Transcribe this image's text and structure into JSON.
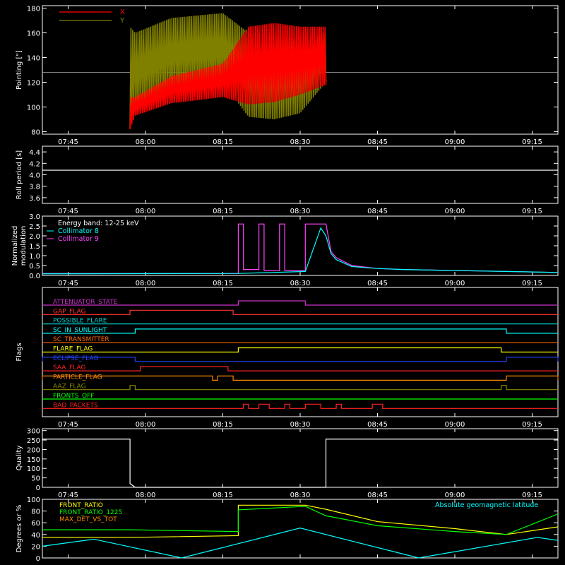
{
  "time_ticks": [
    "07:45",
    "08:00",
    "08:15",
    "08:30",
    "08:45",
    "09:00",
    "09:15"
  ],
  "chart_data": [
    {
      "type": "line",
      "ylabel": "Pointing [\"]",
      "ylim": [
        78,
        182
      ],
      "yticks": [
        "80",
        "100",
        "120",
        "140",
        "160",
        "180"
      ],
      "legend": [
        {
          "name": "X",
          "color": "#ff0000"
        },
        {
          "name": "Y",
          "color": "#808000"
        }
      ],
      "reference_level": 128,
      "series": [
        {
          "name": "X",
          "color": "#ff0000",
          "x": [
            "07:57",
            "07:58",
            "08:05",
            "08:15",
            "08:20",
            "08:25",
            "08:30",
            "08:35"
          ],
          "upper": [
            108,
            108,
            125,
            135,
            165,
            168,
            165,
            165
          ],
          "lower": [
            82,
            93,
            103,
            108,
            102,
            104,
            110,
            118
          ]
        },
        {
          "name": "Y",
          "color": "#808000",
          "x": [
            "07:57",
            "07:58",
            "08:05",
            "08:15",
            "08:20",
            "08:25",
            "08:30",
            "08:35"
          ],
          "upper": [
            165,
            160,
            172,
            176,
            160,
            158,
            155,
            160
          ],
          "lower": [
            82,
            100,
            115,
            120,
            92,
            90,
            95,
            120
          ]
        }
      ]
    },
    {
      "type": "line",
      "ylabel": "Roll period [s]",
      "ylim": [
        3.5,
        4.5
      ],
      "yticks": [
        "3.6",
        "3.8",
        "4.0",
        "4.2",
        "4.4"
      ],
      "series": [
        {
          "name": "roll",
          "color": "#ffffff",
          "x": [
            "07:40",
            "09:20"
          ],
          "y": [
            4.08,
            4.08
          ]
        }
      ]
    },
    {
      "type": "line",
      "ylabel": "Normalized modulation",
      "ylim": [
        0,
        3.0
      ],
      "yticks": [
        "0.0",
        "0.5",
        "1.0",
        "1.5",
        "2.0",
        "2.5",
        "3.0"
      ],
      "legend": [
        {
          "name": "Energy band: 12-25 keV",
          "color": "#ffffff"
        },
        {
          "name": "Collimator 8",
          "color": "#00ffff"
        },
        {
          "name": "Collimator 9",
          "color": "#ff44ff"
        }
      ],
      "series": [
        {
          "name": "Collimator 9",
          "color": "#ff44ff",
          "x": [
            "07:40",
            "08:18",
            "08:18",
            "08:19",
            "08:19",
            "08:22",
            "08:22",
            "08:23",
            "08:23",
            "08:26",
            "08:26",
            "08:27",
            "08:27",
            "08:31",
            "08:31",
            "08:35",
            "08:36",
            "08:37",
            "08:40",
            "08:45",
            "08:50",
            "09:00",
            "09:20"
          ],
          "y": [
            0.1,
            0.1,
            2.6,
            2.6,
            0.3,
            0.3,
            2.6,
            2.6,
            0.25,
            0.25,
            2.6,
            2.6,
            0.25,
            0.25,
            2.6,
            2.6,
            1.2,
            0.9,
            0.5,
            0.35,
            0.3,
            0.25,
            0.15
          ]
        },
        {
          "name": "Collimator 8",
          "color": "#00ffff",
          "x": [
            "07:40",
            "08:18",
            "08:31",
            "08:34",
            "08:35",
            "08:36",
            "08:37",
            "08:40",
            "08:45",
            "08:50",
            "09:00",
            "09:20"
          ],
          "y": [
            0.08,
            0.1,
            0.2,
            2.4,
            2.0,
            1.1,
            0.8,
            0.45,
            0.35,
            0.3,
            0.25,
            0.15
          ]
        }
      ]
    },
    {
      "type": "table",
      "ylabel": "Flags",
      "flags": [
        {
          "name": "ATTENUATOR_STATE",
          "color": "#cc33cc",
          "on": [
            [
              "08:18",
              "08:31"
            ]
          ]
        },
        {
          "name": "GAP_FLAG",
          "color": "#ff3333",
          "on": [
            [
              "07:57",
              "08:17"
            ]
          ]
        },
        {
          "name": "POSSIBLE_FLARE",
          "color": "#00cccc",
          "on": []
        },
        {
          "name": "SC_IN_SUNLIGHT",
          "color": "#00ffff",
          "on": [
            [
              "07:58",
              "09:10"
            ]
          ]
        },
        {
          "name": "SC_TRANSMITTER",
          "color": "#ff6600",
          "on": []
        },
        {
          "name": "FLARE_FLAG",
          "color": "#ffff00",
          "on": [
            [
              "08:18",
              "09:09"
            ]
          ]
        },
        {
          "name": "ECLIPSE_FLAG",
          "color": "#2244ff",
          "on": [
            [
              "07:40",
              "07:58"
            ],
            [
              "09:10",
              "09:20"
            ]
          ]
        },
        {
          "name": "SAA_FLAG",
          "color": "#ff2222",
          "on": [
            [
              "07:59",
              "08:16"
            ]
          ]
        },
        {
          "name": "PARTICLE_FLAG",
          "color": "#ff8800",
          "on": [
            [
              "07:40",
              "08:13"
            ],
            [
              "08:14",
              "08:17"
            ],
            [
              "09:10",
              "09:20"
            ]
          ]
        },
        {
          "name": "AAZ_FLAG",
          "color": "#888800",
          "on": [
            [
              "07:57",
              "07:58"
            ],
            [
              "09:09",
              "09:10"
            ]
          ]
        },
        {
          "name": "FRONTS_OFF",
          "color": "#00ff00",
          "on": []
        },
        {
          "name": "BAD_PACKETS",
          "color": "#ff2222",
          "on": [
            [
              "08:19",
              "08:20"
            ],
            [
              "08:22",
              "08:24"
            ],
            [
              "08:27",
              "08:28"
            ],
            [
              "08:31",
              "08:34"
            ],
            [
              "08:37",
              "08:38"
            ],
            [
              "08:44",
              "08:46"
            ]
          ]
        }
      ]
    },
    {
      "type": "line",
      "ylabel": "Quality",
      "ylim": [
        0,
        310
      ],
      "yticks": [
        "0",
        "50",
        "100",
        "150",
        "200",
        "250",
        "300"
      ],
      "series": [
        {
          "name": "Quality",
          "color": "#ffffff",
          "x": [
            "07:40",
            "07:57",
            "07:57",
            "07:58",
            "08:35",
            "08:35",
            "09:20"
          ],
          "y": [
            255,
            255,
            20,
            0,
            0,
            255,
            255
          ]
        }
      ]
    },
    {
      "type": "line",
      "ylabel": "Degrees or %",
      "ylim": [
        0,
        100
      ],
      "yticks": [
        "0",
        "20",
        "40",
        "60",
        "80",
        "100"
      ],
      "legend": [
        {
          "name": "FRONT_RATIO",
          "color": "#ffff00"
        },
        {
          "name": "FRONT_RATIO_1225",
          "color": "#00ff00"
        },
        {
          "name": "MAX_DET_VS_TOT",
          "color": "#ff8800"
        }
      ],
      "annotation": {
        "text": "Absolute geomagnetic latitude",
        "color": "#00ffff"
      },
      "series": [
        {
          "name": "FRONT_RATIO",
          "color": "#ffff00",
          "x": [
            "07:40",
            "07:57",
            "08:18",
            "08:18",
            "08:31",
            "08:35",
            "08:45",
            "09:00",
            "09:10",
            "09:20"
          ],
          "y": [
            35,
            35,
            38,
            90,
            90,
            83,
            62,
            50,
            40,
            53
          ]
        },
        {
          "name": "FRONT_RATIO_1225",
          "color": "#00ff00",
          "x": [
            "07:40",
            "07:57",
            "08:18",
            "08:18",
            "08:31",
            "08:35",
            "08:45",
            "09:00",
            "09:10",
            "09:20"
          ],
          "y": [
            48,
            48,
            45,
            82,
            88,
            72,
            55,
            45,
            40,
            75
          ]
        },
        {
          "name": "Absolute geomagnetic latitude",
          "color": "#00ffff",
          "x": [
            "07:40",
            "07:50",
            "08:07",
            "08:30",
            "08:53",
            "09:16",
            "09:20"
          ],
          "y": [
            20,
            32,
            0,
            51,
            0,
            35,
            30
          ]
        }
      ]
    }
  ]
}
